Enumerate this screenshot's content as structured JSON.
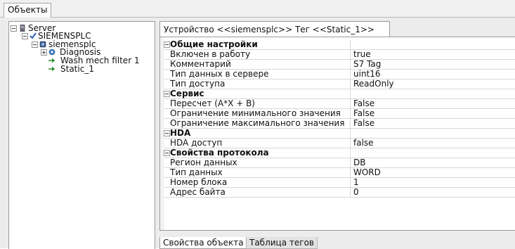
{
  "top_tab": {
    "label": "Объекты"
  },
  "tree": {
    "server": "Server",
    "device_root": "SIEMENSPLC",
    "device": "siemensplc",
    "diagnosis": "Diagnosis",
    "tag_wash": "Wash mech filter 1",
    "tag_static": "Static_1"
  },
  "main_tab": {
    "label": "Устройство <<siemensplc>> Тег  <<Static_1>>"
  },
  "grid": {
    "general": {
      "title": "Общие настройки",
      "rows": [
        {
          "name": "Включен в работу",
          "value": "true"
        },
        {
          "name": "Комментарий",
          "value": "S7 Tag"
        },
        {
          "name": "Тип данных в сервере",
          "value": "uint16"
        },
        {
          "name": "Тип доступа",
          "value": "ReadOnly"
        }
      ]
    },
    "service": {
      "title": "Сервис",
      "rows": [
        {
          "name": "Пересчет (A*X + B)",
          "value": "False"
        },
        {
          "name": "Ограничение минимального значения",
          "value": "False"
        },
        {
          "name": "Ограничение максимального значения",
          "value": "False"
        }
      ]
    },
    "hda": {
      "title": "HDA",
      "rows": [
        {
          "name": "HDA доступ",
          "value": "false"
        }
      ]
    },
    "protocol": {
      "title": "Свойства протокола",
      "rows": [
        {
          "name": "Регион данных",
          "value": "DB"
        },
        {
          "name": "Тип данных",
          "value": "WORD"
        },
        {
          "name": "Номер блока",
          "value": "1"
        },
        {
          "name": "Адрес байта",
          "value": "0"
        }
      ]
    }
  },
  "bottom_tabs": {
    "properties": "Свойства объекта",
    "tags_table": "Таблица тегов"
  }
}
